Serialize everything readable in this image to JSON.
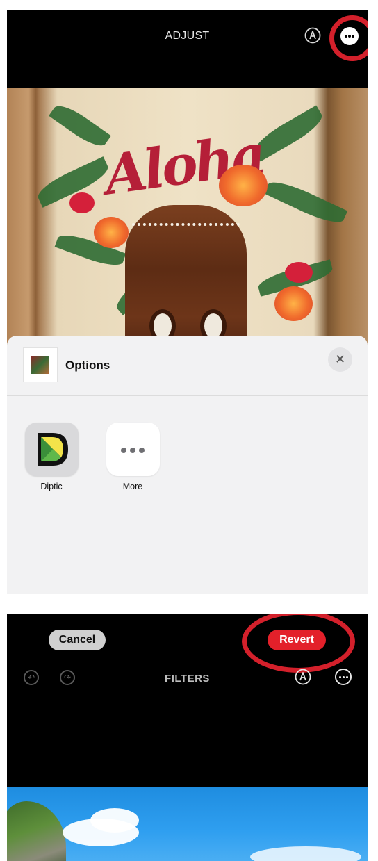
{
  "screen1": {
    "header": {
      "title": "ADJUST"
    },
    "icons": {
      "markup": "markup-pen-icon",
      "more": "more-ellipsis-icon"
    },
    "sheet": {
      "title": "Options",
      "close_label": "✕",
      "apps": [
        {
          "label": "Diptic"
        },
        {
          "label": "More"
        }
      ]
    },
    "photo": {
      "text": "Aloha"
    }
  },
  "screen2": {
    "toolbar": {
      "cancel_label": "Cancel",
      "revert_label": "Revert"
    },
    "header": {
      "title": "FILTERS"
    },
    "icons": {
      "undo": "undo-icon",
      "redo": "redo-icon",
      "markup": "markup-pen-icon",
      "more": "more-ellipsis-icon"
    }
  },
  "colors": {
    "highlight_ring": "#d3202b",
    "revert_button": "#e3202a",
    "sheet_background": "#f2f2f3"
  }
}
